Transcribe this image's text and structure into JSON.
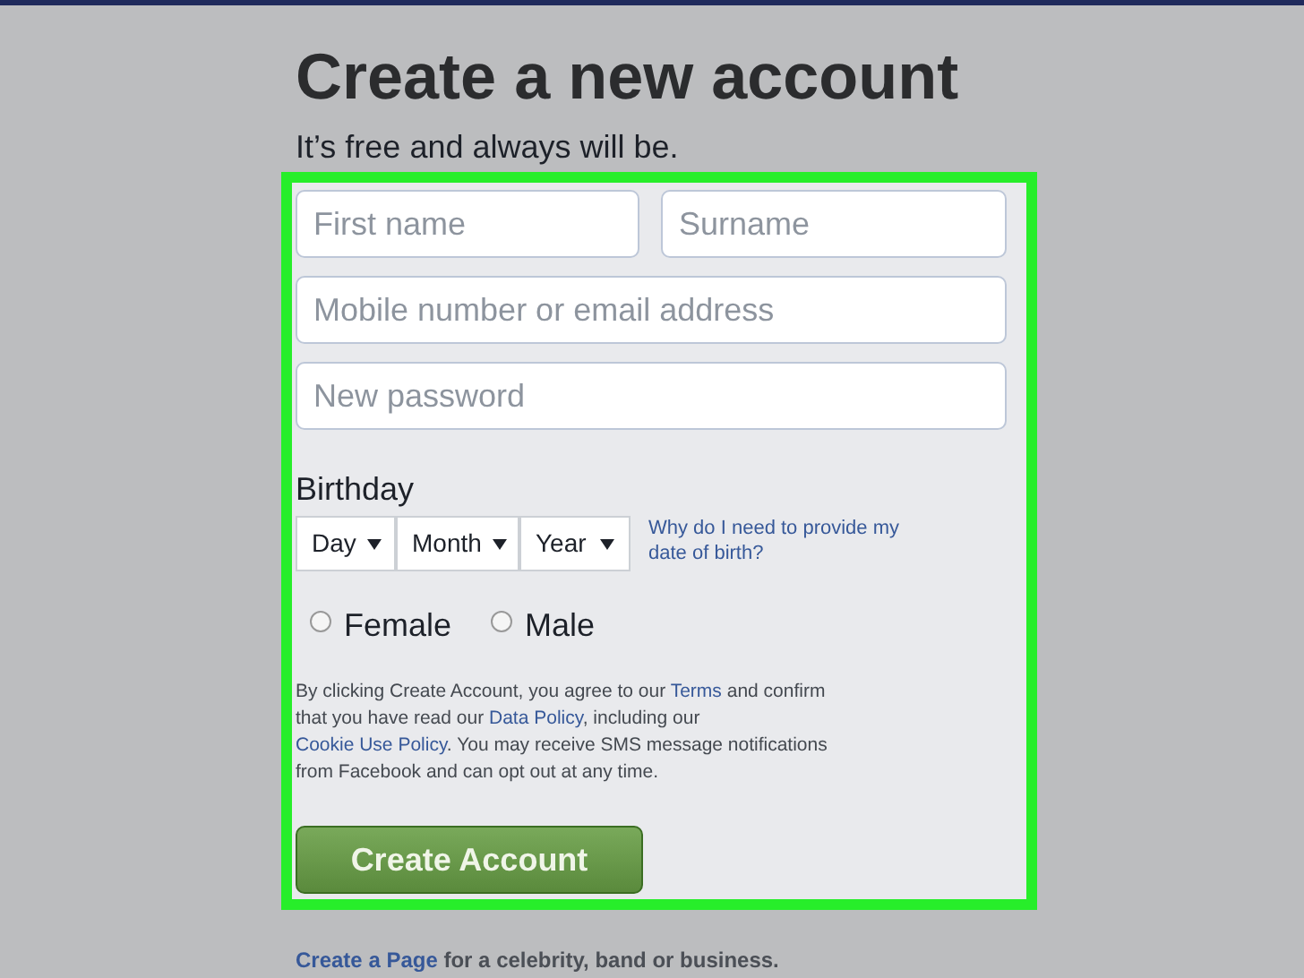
{
  "title": "Create a new account",
  "subtitle": "It’s free and always will be.",
  "fields": [
    {
      "placeholder": "First name"
    },
    {
      "placeholder": "Surname"
    },
    {
      "placeholder": "Mobile number or email address"
    },
    {
      "placeholder": "New password"
    }
  ],
  "birthday": {
    "label": "Birthday",
    "selects": [
      {
        "value": "Day"
      },
      {
        "value": "Month"
      },
      {
        "value": "Year"
      }
    ],
    "help_link": "Why do I need to provide my date of birth?"
  },
  "gender": [
    {
      "label": "Female",
      "selected": false
    },
    {
      "label": "Male",
      "selected": false
    }
  ],
  "terms": [
    {
      "text": "By clicking Create Account, you agree to our ",
      "link": false
    },
    {
      "text": "Terms",
      "link": true
    },
    {
      "text": " and confirm that you have read our ",
      "link": false
    },
    {
      "text": "Data Policy",
      "link": true
    },
    {
      "text": ", including our ",
      "link": false
    },
    {
      "text": "Cookie Use Policy",
      "link": true
    },
    {
      "text": ". You may receive SMS message notifications from Facebook and can opt out at any time.",
      "link": false
    }
  ],
  "submit": "Create Account",
  "footer": [
    {
      "text": "Create a Page",
      "link": true
    },
    {
      "text": " for a celebrity, band or business.",
      "link": false
    }
  ]
}
